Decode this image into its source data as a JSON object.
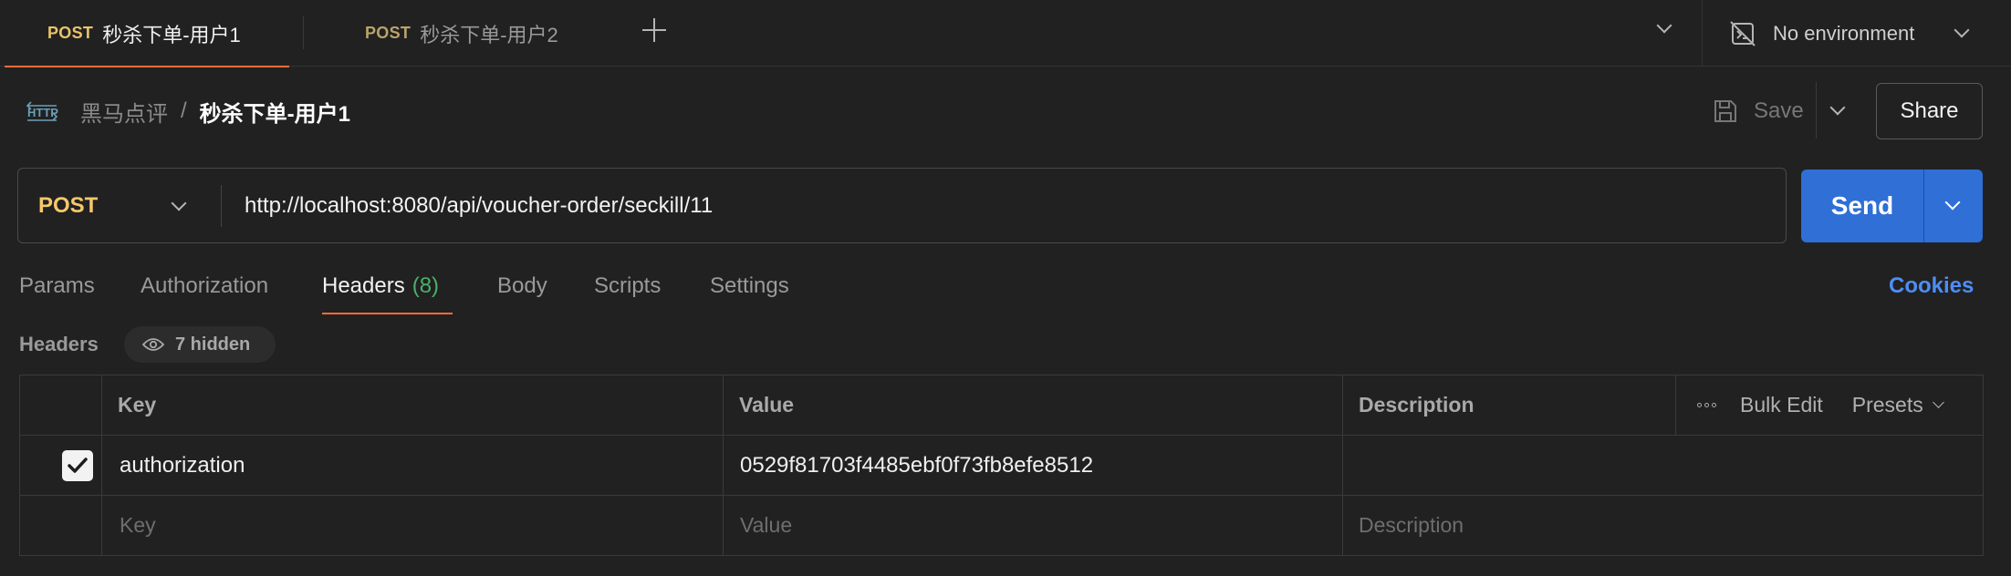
{
  "tabs": [
    {
      "method": "POST",
      "title": "秒杀下单-用户1",
      "active": true
    },
    {
      "method": "POST",
      "title": "秒杀下单-用户2",
      "active": false
    }
  ],
  "environment": {
    "label": "No environment"
  },
  "breadcrumb": {
    "parent": "黑马点评",
    "separator": "/",
    "current": "秒杀下单-用户1"
  },
  "actions": {
    "save_label": "Save",
    "share_label": "Share"
  },
  "request": {
    "method": "POST",
    "url": "http://localhost:8080/api/voucher-order/seckill/11",
    "send_label": "Send"
  },
  "request_tabs": [
    {
      "label": "Params"
    },
    {
      "label": "Authorization"
    },
    {
      "label": "Headers",
      "count": "(8)",
      "active": true
    },
    {
      "label": "Body"
    },
    {
      "label": "Scripts"
    },
    {
      "label": "Settings"
    }
  ],
  "cookies_label": "Cookies",
  "headers_section": {
    "label": "Headers",
    "hidden_label": "7 hidden"
  },
  "table": {
    "columns": {
      "key": "Key",
      "value": "Value",
      "description": "Description"
    },
    "bulk_edit_label": "Bulk Edit",
    "presets_label": "Presets",
    "rows": [
      {
        "checked": true,
        "key": "authorization",
        "value": "0529f81703f4485ebf0f73fb8efe8512",
        "description": ""
      }
    ],
    "placeholder": {
      "key": "Key",
      "value": "Value",
      "description": "Description"
    }
  },
  "colors": {
    "accent_orange": "#ff6c37",
    "send_blue": "#2f6fd6",
    "method_yellow": "#f5c86b",
    "cookies_blue": "#4e8df5",
    "count_green": "#4caf6a"
  },
  "icons": [
    "plus-icon",
    "chevron-down-icon",
    "environment-off-icon",
    "http-icon",
    "save-icon",
    "eye-icon",
    "checkbox-checked-icon",
    "more-icon"
  ]
}
